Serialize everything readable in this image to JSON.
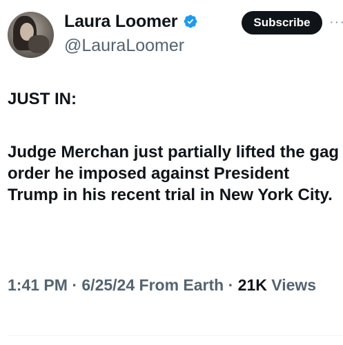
{
  "author": {
    "display_name": "Laura Loomer",
    "handle": "@LauraLoomer",
    "verified": true,
    "verified_color": "#1d9bf0"
  },
  "actions": {
    "subscribe_label": "Subscribe",
    "more_label": "···"
  },
  "tweet": {
    "lead": "JUST IN:",
    "body": "Judge Merchan just partially lifted the gag order he imposed against President Trump in his recent trial in New York City."
  },
  "meta": {
    "time": "1:41 PM",
    "date": "6/25/24",
    "source": "From Earth",
    "separator": "·",
    "views_count": "21K",
    "views_label": "Views"
  },
  "icons": {
    "verified": "verified-badge-icon",
    "more": "more-options-icon"
  }
}
